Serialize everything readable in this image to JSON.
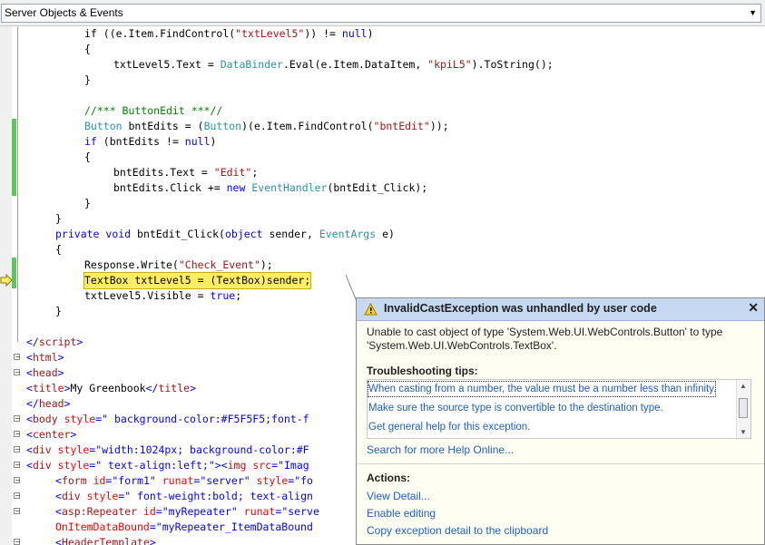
{
  "toolbar": {
    "combo_value": "Server Objects & Events"
  },
  "exception": {
    "title": "InvalidCastException was unhandled by user code",
    "message": "Unable to cast object of type 'System.Web.UI.WebControls.Button' to type 'System.Web.UI.WebControls.TextBox'.",
    "tips_header": "Troubleshooting tips:",
    "tips": [
      "When casting from a number, the value must be a number less than infinity.",
      "Make sure the source type is convertible to the destination type.",
      "Get general help for this exception."
    ],
    "search_link": "Search for more Help Online...",
    "actions_header": "Actions:",
    "actions": [
      "View Detail...",
      "Enable editing",
      "Copy exception detail to the clipboard"
    ]
  },
  "code": {
    "l1_a": "if ((e.Item.FindControl(",
    "l1_s": "\"txtLevel5\"",
    "l1_b": ")) != ",
    "l1_c": "null",
    "l1_d": ")",
    "l2": "{",
    "l3_a": "txtLevel5.Text = ",
    "l3_t": "DataBinder",
    "l3_b": ".Eval(e.Item.DataItem, ",
    "l3_s": "\"kpiL5\"",
    "l3_c": ").ToString();",
    "l4": "}",
    "l5": "//*** ButtonEdit ***//",
    "l6_t": "Button",
    "l6_a": " bntEdits = (",
    "l6_t2": "Button",
    "l6_b": ")(e.Item.FindControl(",
    "l6_s": "\"bntEdit\"",
    "l6_c": "));",
    "l7_k": "if",
    "l7_a": " (bntEdits != ",
    "l7_n": "null",
    "l7_b": ")",
    "l8": "{",
    "l9_a": "bntEdits.Text = ",
    "l9_s": "\"Edit\"",
    "l9_b": ";",
    "l10_a": "bntEdits.Click += ",
    "l10_k": "new",
    "l10_sp": " ",
    "l10_t": "EventHandler",
    "l10_b": "(bntEdit_Click);",
    "l11": "}",
    "l12": "}",
    "l13_k1": "private",
    "l13_k2": "void",
    "l13_a": " bntEdit_Click(",
    "l13_k3": "object",
    "l13_b": " sender, ",
    "l13_t": "EventArgs",
    "l13_c": " e)",
    "l14": "{",
    "l15_a": "Response.Write(",
    "l15_s": "\"Check_Event\"",
    "l15_b": ");",
    "l16": "TextBox txtLevel5 = (TextBox)sender;",
    "l17_a": "txtLevel5.Visible = ",
    "l17_k": "true",
    "l17_b": ";",
    "l18": "}",
    "l19_a": "</",
    "l19_b": "script",
    "l19_c": ">",
    "l20": "html",
    "l21": "head",
    "l22_tag": "title",
    "l22_txt": "My Greenbook",
    "l23": "head",
    "l24_tag": "body",
    "l24_attr": " style",
    "l24_val": "\" background-color:#F5F5F5;font-f",
    "l25": "center",
    "l26_tag": "div",
    "l26_attr": " style",
    "l26_val": "\"width:1024px; background-color:#F",
    "l27_tag": "div",
    "l27_attr": " style",
    "l27_val": "\" text-align:left;\"",
    "l27_img": "img",
    "l27_src": " src",
    "l27_srcv": "\"Imag",
    "l28_tag": "form",
    "l28_id": " id",
    "l28_idv": "\"form1\"",
    "l28_rn": " runat",
    "l28_rnv": "\"server\"",
    "l28_st": " style",
    "l28_stv": "\"fo",
    "l29_tag": "div",
    "l29_attr": " style",
    "l29_val": "\" font-weight:bold; text-align",
    "l30_tag": "asp:Repeater",
    "l30_id": " id",
    "l30_idv": "\"myRepeater\"",
    "l30_rn": " runat",
    "l30_rnv": "\"serve",
    "l31_attr": "OnItemDataBound",
    "l31_val": "\"myRepeater_ItemDataBound",
    "l32_tag": "HeaderTemplate"
  }
}
